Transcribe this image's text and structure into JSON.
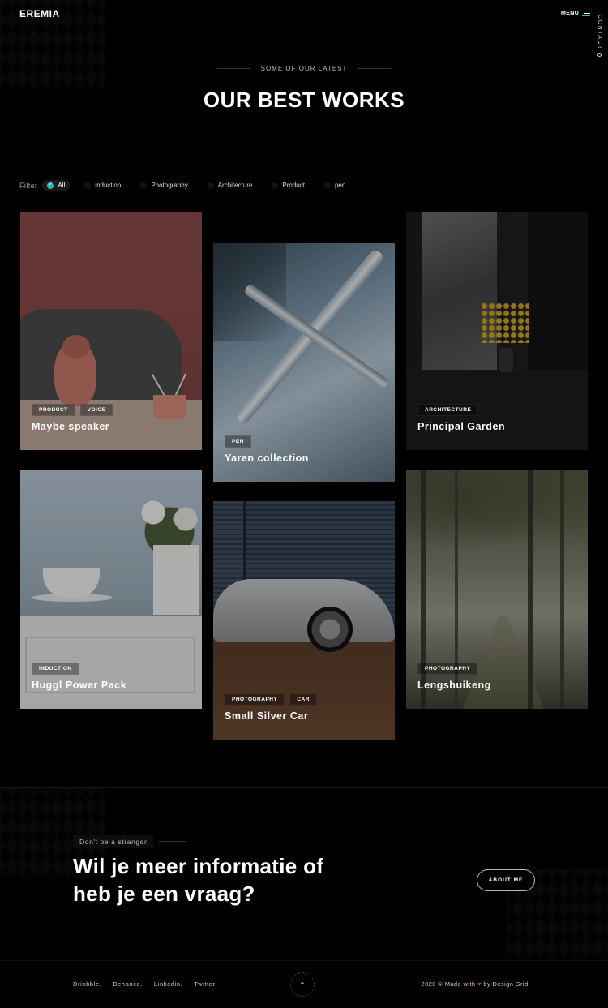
{
  "header": {
    "logo": "EREMIA",
    "menu_label": "MENU",
    "contact_label": "CONTACT"
  },
  "section": {
    "subtitle": "SOME OF OUR LATEST",
    "title": "OUR BEST WORKS"
  },
  "filter": {
    "label": "Filter",
    "options": [
      "All",
      "induction",
      "Photography",
      "Architecture",
      "Product",
      "pen"
    ],
    "active": "All"
  },
  "works": [
    {
      "title": "Maybe speaker",
      "tags": [
        "PRODUCT",
        "VOICE"
      ]
    },
    {
      "title": "Yaren collection",
      "tags": [
        "PEN"
      ]
    },
    {
      "title": "Principal Garden",
      "tags": [
        "ARCHITECTURE"
      ]
    },
    {
      "title": "Huggl Power Pack",
      "tags": [
        "INDUCTION"
      ]
    },
    {
      "title": "Small Silver Car",
      "tags": [
        "PHOTOGRAPHY",
        "CAR"
      ]
    },
    {
      "title": "Lengshuikeng",
      "tags": [
        "PHOTOGRAPHY"
      ]
    }
  ],
  "cta": {
    "subtitle": "Don't be a stranger",
    "title_line1": "Wil je meer informatie of",
    "title_line2": "heb je een vraag?",
    "button_label": "ABOUT ME"
  },
  "footer": {
    "links": [
      "Dribbble.",
      "Behance.",
      "Linkedin.",
      "Twitter."
    ],
    "scroll_icon": "chevron-up-icon",
    "copyright_prefix": "2020 © Made with",
    "copyright_suffix": "by Design Grid."
  },
  "colors": {
    "accent": "#2bb3c0",
    "heart": "#e23030",
    "background": "#000000"
  }
}
